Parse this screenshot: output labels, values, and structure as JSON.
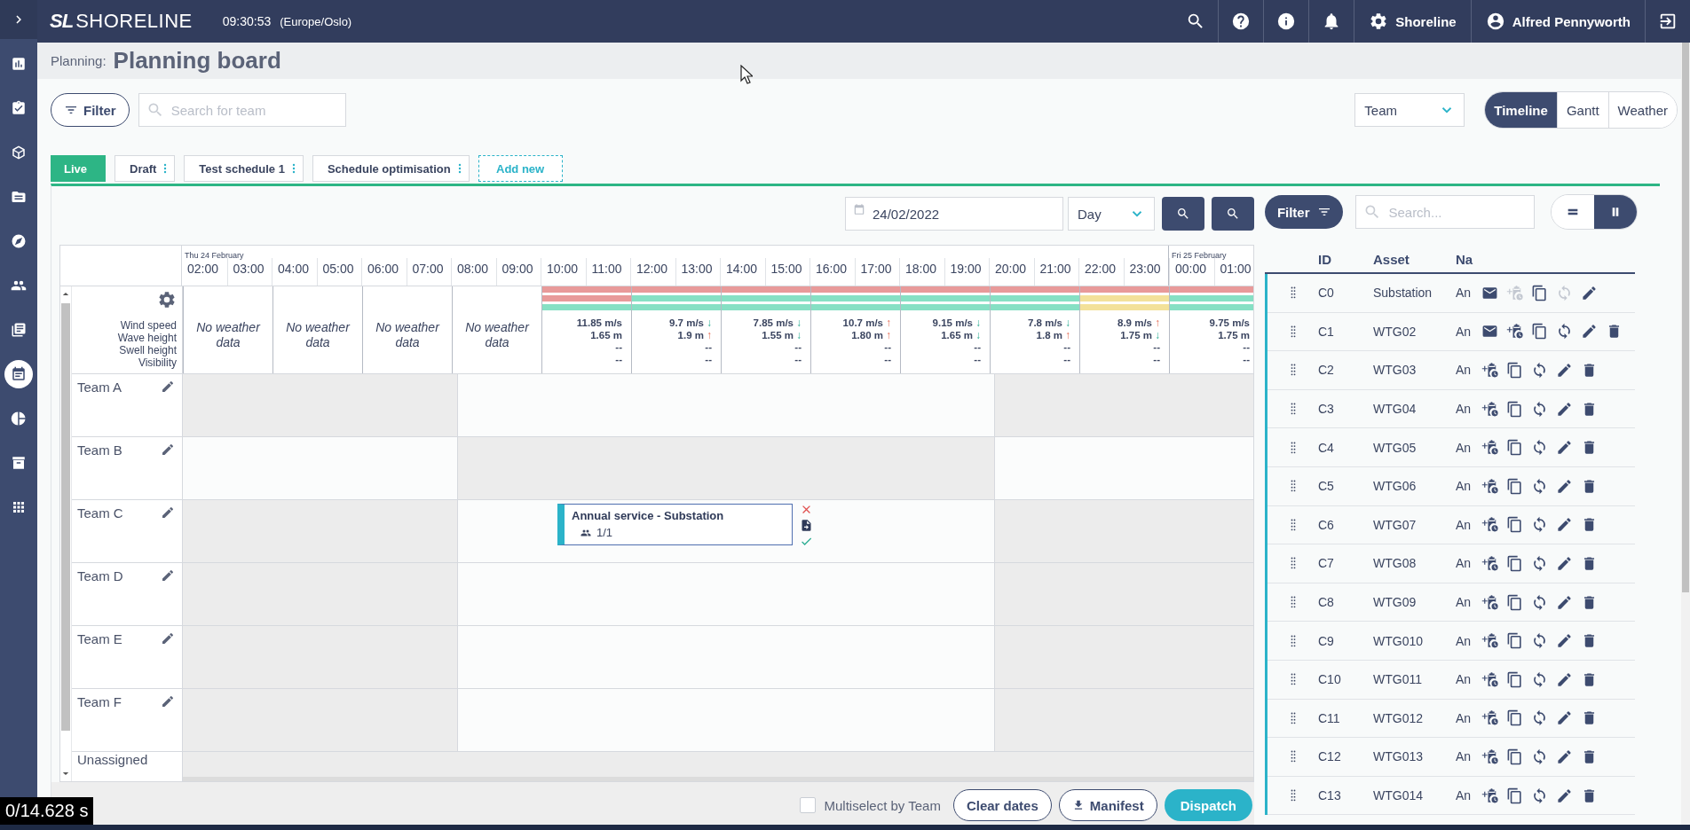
{
  "nav_rail": [
    {
      "kind": "expand",
      "selected": false
    },
    {
      "kind": "reports",
      "selected": false
    },
    {
      "kind": "tasks",
      "selected": false
    },
    {
      "kind": "assets",
      "selected": false
    },
    {
      "kind": "documents",
      "selected": false
    },
    {
      "kind": "navigation",
      "selected": false
    },
    {
      "kind": "teams",
      "selected": false
    },
    {
      "kind": "logs",
      "selected": false
    },
    {
      "kind": "planning",
      "selected": true
    },
    {
      "kind": "analytics",
      "selected": false
    },
    {
      "kind": "archive",
      "selected": false
    },
    {
      "kind": "apps",
      "selected": false
    }
  ],
  "top_bar": {
    "logo_mark": "SL",
    "logo_text": "SHORELINE",
    "time": "09:30:53",
    "timezone": "(Europe/Oslo)",
    "organisation": "Shoreline",
    "user": "Alfred Pennyworth"
  },
  "page_header": {
    "breadcrumb": "Planning:",
    "title": "Planning board"
  },
  "toolbar": {
    "filter": "Filter",
    "search_placeholder": "Search for team",
    "group_by": "Team",
    "views": [
      {
        "label": "Timeline",
        "selected": true
      },
      {
        "label": "Gantt",
        "selected": false
      },
      {
        "label": "Weather",
        "selected": false
      }
    ]
  },
  "schedule_tabs": [
    {
      "label": "Live",
      "selected": true,
      "menu": false
    },
    {
      "label": "Draft",
      "selected": false,
      "menu": true
    },
    {
      "label": "Test schedule 1",
      "selected": false,
      "menu": true
    },
    {
      "label": "Schedule optimisation",
      "selected": false,
      "menu": true
    }
  ],
  "add_tab": "Add new",
  "board": {
    "date": "24/02/2022",
    "range": "Day",
    "hours": [
      {
        "label": "02:00",
        "day": "Thu 24 February"
      },
      {
        "label": "03:00"
      },
      {
        "label": "04:00"
      },
      {
        "label": "05:00"
      },
      {
        "label": "06:00"
      },
      {
        "label": "07:00"
      },
      {
        "label": "08:00"
      },
      {
        "label": "09:00"
      },
      {
        "label": "10:00"
      },
      {
        "label": "11:00"
      },
      {
        "label": "12:00"
      },
      {
        "label": "13:00"
      },
      {
        "label": "14:00"
      },
      {
        "label": "15:00"
      },
      {
        "label": "16:00"
      },
      {
        "label": "17:00"
      },
      {
        "label": "18:00"
      },
      {
        "label": "19:00"
      },
      {
        "label": "20:00"
      },
      {
        "label": "21:00"
      },
      {
        "label": "22:00"
      },
      {
        "label": "23:00"
      },
      {
        "label": "00:00",
        "day": "Fri 25 February"
      },
      {
        "label": "01:00"
      }
    ],
    "weather_labels": [
      "Wind speed",
      "Wave height",
      "Swell height",
      "Visibility"
    ],
    "weather": [
      {
        "kind": "empty",
        "text": "No weather data"
      },
      {
        "kind": "empty",
        "text": "No weather data"
      },
      {
        "kind": "empty",
        "text": "No weather data"
      },
      {
        "kind": "empty",
        "text": "No weather data"
      },
      {
        "kind": "data",
        "bars": [
          {
            "color": "#e89a9a"
          },
          {
            "color": "#e89a9a"
          },
          {
            "color": "#86e0c4"
          }
        ],
        "wind": "11.85 m/s",
        "wave": "1.65 m",
        "swell": "--",
        "visibility": "--"
      },
      {
        "kind": "data",
        "bars": [
          {
            "color": "#e89a9a"
          },
          {
            "color": "#86e0c4"
          },
          {
            "color": "#86e0c4"
          }
        ],
        "wind": "9.7 m/s",
        "wind_arrow": "↓",
        "wind_rising": false,
        "wave": "1.9 m",
        "wave_arrow": "↑",
        "wave_rising": true,
        "swell": "--",
        "visibility": "--"
      },
      {
        "kind": "data",
        "bars": [
          {
            "color": "#e89a9a"
          },
          {
            "color": "#86e0c4"
          },
          {
            "color": "#86e0c4"
          }
        ],
        "wind": "7.85 m/s",
        "wind_arrow": "↓",
        "wind_rising": false,
        "wave": "1.55 m",
        "wave_arrow": "↓",
        "wave_rising": false,
        "swell": "--",
        "visibility": "--"
      },
      {
        "kind": "data",
        "bars": [
          {
            "color": "#e89a9a"
          },
          {
            "color": "#86e0c4"
          },
          {
            "color": "#86e0c4"
          }
        ],
        "wind": "10.7 m/s",
        "wind_arrow": "↑",
        "wind_rising": true,
        "wave": "1.80 m",
        "wave_arrow": "↑",
        "wave_rising": true,
        "swell": "--",
        "visibility": "--"
      },
      {
        "kind": "data",
        "bars": [
          {
            "color": "#e89a9a"
          },
          {
            "color": "#86e0c4"
          },
          {
            "color": "#86e0c4"
          }
        ],
        "wind": "9.15 m/s",
        "wind_arrow": "↓",
        "wind_rising": false,
        "wave": "1.65 m",
        "wave_arrow": "↓",
        "wave_rising": false,
        "swell": "--",
        "visibility": "--"
      },
      {
        "kind": "data",
        "bars": [
          {
            "color": "#e89a9a"
          },
          {
            "color": "#86e0c4"
          },
          {
            "color": "#86e0c4"
          }
        ],
        "wind": "7.8 m/s",
        "wind_arrow": "↓",
        "wind_rising": false,
        "wave": "1.8 m",
        "wave_arrow": "↑",
        "wave_rising": true,
        "swell": "--",
        "visibility": "--"
      },
      {
        "kind": "data",
        "bars": [
          {
            "color": "#e89a9a"
          },
          {
            "color": "#f3e19a"
          },
          {
            "color": "#f3e19a"
          }
        ],
        "wind": "8.9 m/s",
        "wind_arrow": "↑",
        "wind_rising": true,
        "wave": "1.75 m",
        "wave_arrow": "↓",
        "wave_rising": false,
        "swell": "--",
        "visibility": "--"
      },
      {
        "kind": "data",
        "bars": [
          {
            "color": "#e89a9a"
          },
          {
            "color": "#86e0c4"
          },
          {
            "color": "#86e0c4"
          }
        ],
        "wind": "9.75 m/s",
        "wave": "1.75 m",
        "swell": "--",
        "visibility": "--"
      }
    ],
    "teams": [
      {
        "name": "Team A",
        "available": [
          false,
          true,
          false
        ]
      },
      {
        "name": "Team B",
        "available": [
          true,
          false,
          true
        ]
      },
      {
        "name": "Team C",
        "available": [
          false,
          true,
          false
        ],
        "events": [
          {
            "title": "Annual service - Substation",
            "crew": "1/1"
          }
        ]
      },
      {
        "name": "Team D",
        "available": [
          false,
          true,
          false
        ]
      },
      {
        "name": "Team E",
        "available": [
          false,
          true,
          false
        ]
      },
      {
        "name": "Team F",
        "available": [
          false,
          true,
          false
        ]
      }
    ],
    "unassigned": "Unassigned"
  },
  "footer": {
    "multiselect": {
      "label": "Multiselect by Team",
      "checked": false
    },
    "buttons": [
      {
        "kind": "outline",
        "label": "Clear dates"
      },
      {
        "kind": "download",
        "label": "Manifest"
      },
      {
        "kind": "primary",
        "label": "Dispatch"
      }
    ]
  },
  "asset_panel": {
    "filter": "Filter",
    "search_placeholder": "Search...",
    "layouts": [
      {
        "kind": "rows",
        "selected": false
      },
      {
        "kind": "columns",
        "selected": true
      }
    ],
    "columns": [
      "ID",
      "Asset",
      "Na"
    ],
    "rows": [
      {
        "id": "C0",
        "asset": "Substation",
        "name": "An",
        "mail": true,
        "add_disabled": true,
        "sync_disabled": true,
        "delete": false
      },
      {
        "id": "C1",
        "asset": "WTG02",
        "name": "An",
        "mail": true,
        "add_disabled": false,
        "sync_disabled": false,
        "delete": true
      },
      {
        "id": "C2",
        "asset": "WTG03",
        "name": "An",
        "mail": false,
        "add_disabled": false,
        "sync_disabled": false,
        "delete": true
      },
      {
        "id": "C3",
        "asset": "WTG04",
        "name": "An",
        "mail": false,
        "add_disabled": false,
        "sync_disabled": false,
        "delete": true
      },
      {
        "id": "C4",
        "asset": "WTG05",
        "name": "An",
        "mail": false,
        "add_disabled": false,
        "sync_disabled": false,
        "delete": true
      },
      {
        "id": "C5",
        "asset": "WTG06",
        "name": "An",
        "mail": false,
        "add_disabled": false,
        "sync_disabled": false,
        "delete": true
      },
      {
        "id": "C6",
        "asset": "WTG07",
        "name": "An",
        "mail": false,
        "add_disabled": false,
        "sync_disabled": false,
        "delete": true
      },
      {
        "id": "C7",
        "asset": "WTG08",
        "name": "An",
        "mail": false,
        "add_disabled": false,
        "sync_disabled": false,
        "delete": true
      },
      {
        "id": "C8",
        "asset": "WTG09",
        "name": "An",
        "mail": false,
        "add_disabled": false,
        "sync_disabled": false,
        "delete": true
      },
      {
        "id": "C9",
        "asset": "WTG010",
        "name": "An",
        "mail": false,
        "add_disabled": false,
        "sync_disabled": false,
        "delete": true
      },
      {
        "id": "C10",
        "asset": "WTG011",
        "name": "An",
        "mail": false,
        "add_disabled": false,
        "sync_disabled": false,
        "delete": true
      },
      {
        "id": "C11",
        "asset": "WTG012",
        "name": "An",
        "mail": false,
        "add_disabled": false,
        "sync_disabled": false,
        "delete": true
      },
      {
        "id": "C12",
        "asset": "WTG013",
        "name": "An",
        "mail": false,
        "add_disabled": false,
        "sync_disabled": false,
        "delete": true
      },
      {
        "id": "C13",
        "asset": "WTG014",
        "name": "An",
        "mail": false,
        "add_disabled": false,
        "sync_disabled": false,
        "delete": true
      }
    ]
  },
  "recording_timer": "0/14.628 s"
}
